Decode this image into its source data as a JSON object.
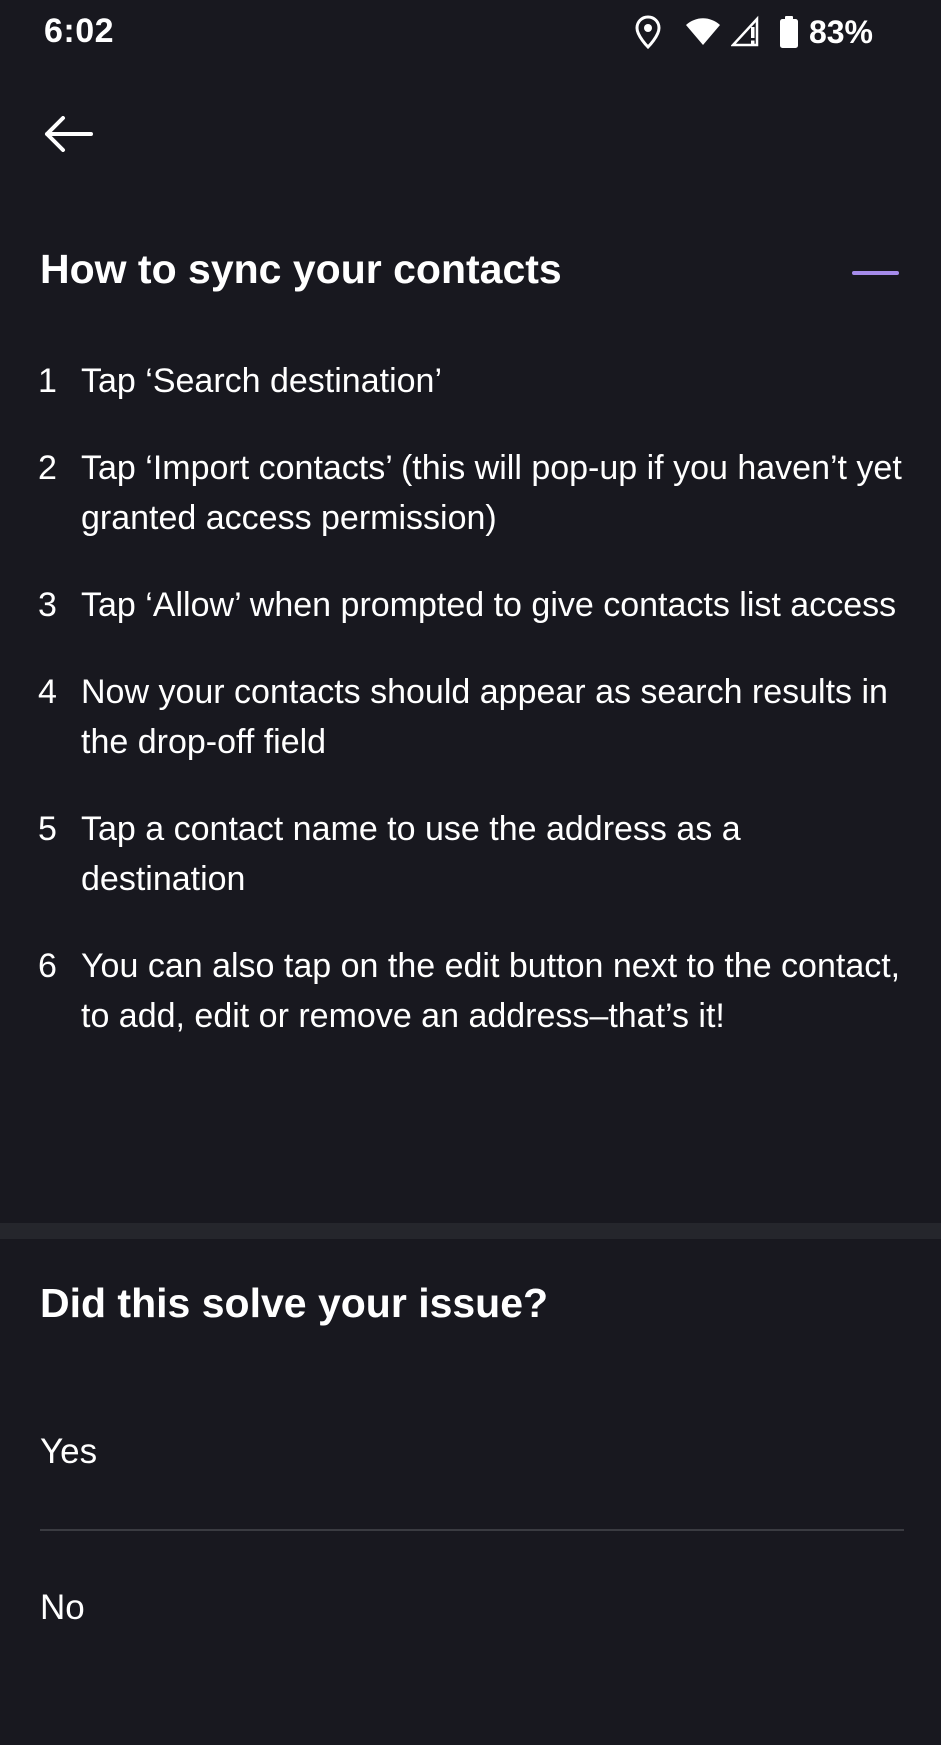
{
  "status_bar": {
    "time": "6:02",
    "battery": "83%",
    "icons": [
      "location-icon",
      "wifi-icon",
      "signal-icon",
      "battery-icon"
    ]
  },
  "back_icon": "arrow-left-icon",
  "help": {
    "title": "How to sync your contacts",
    "expanded_icon": "minus-icon",
    "accent_color": "#a58bea",
    "steps": [
      {
        "num": "1",
        "text": "Tap ‘Search destination’"
      },
      {
        "num": "2",
        "text": "Tap ‘Import contacts’ (this will pop-up if you haven’t yet granted access permission)"
      },
      {
        "num": "3",
        "text": "Tap ‘Allow’ when prompted to give contacts list access"
      },
      {
        "num": "4",
        "text": "Now your contacts should appear as search results in the drop-off field"
      },
      {
        "num": "5",
        "text": "Tap a contact name to use the address as a destination"
      },
      {
        "num": "6",
        "text": "You can also tap on the edit button next to the contact, to add, edit or remove an address–that’s it!"
      }
    ]
  },
  "feedback": {
    "question": "Did this solve your issue?",
    "yes_label": "Yes",
    "no_label": "No"
  },
  "colors": {
    "background": "#18181f",
    "divider_band": "#25262c",
    "divider_line": "#3a3b41",
    "text": "#ffffff"
  }
}
